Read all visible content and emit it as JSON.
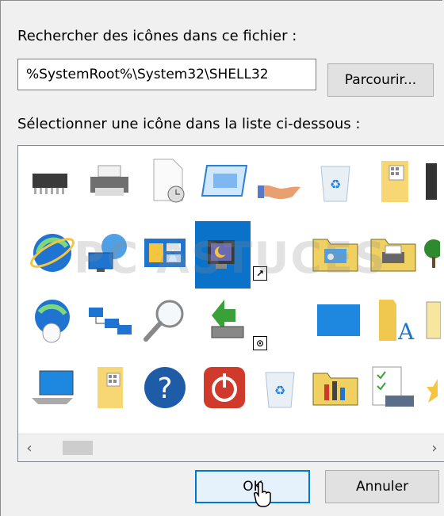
{
  "dialog": {
    "search_label": "Rechercher des icônes dans ce fichier :",
    "file_path": "%SystemRoot%\\System32\\SHELL32",
    "browse_label": "Parcourir...",
    "select_label": "Sélectionner une icône dans la liste ci-dessous :",
    "ok_label": "OK",
    "cancel_label": "Annuler"
  },
  "icons": {
    "row1": [
      "chip-icon",
      "printer-icon",
      "document-clock-icon",
      "screen-window-icon",
      "hand-share-icon",
      "recycle-bin-empty-icon",
      "folder-grid-icon",
      "device-icon"
    ],
    "row2": [
      "ie-globe-icon",
      "network-globe-icon",
      "control-panel-icon",
      "monitor-moon-icon",
      "shortcut-arrow-icon",
      "folder-network-icon",
      "folder-printer-icon",
      "tree-icon"
    ],
    "row3": [
      "globe-mouse-icon",
      "network-lan-icon",
      "magnifier-icon",
      "green-arrow-drive-icon",
      "clock-badge-icon",
      "blue-desktop-icon",
      "folder-font-icon",
      "folder-partial-icon"
    ],
    "row4": [
      "computer-icon",
      "folder-grid-icon",
      "help-icon",
      "shutdown-icon",
      "recycle-bin-icon",
      "folder-tools-icon",
      "checklist-icon",
      "star-icon"
    ]
  },
  "watermark": "PC ASTUCES",
  "colors": {
    "selection": "#0a72c9",
    "accent": "#0078d7"
  }
}
